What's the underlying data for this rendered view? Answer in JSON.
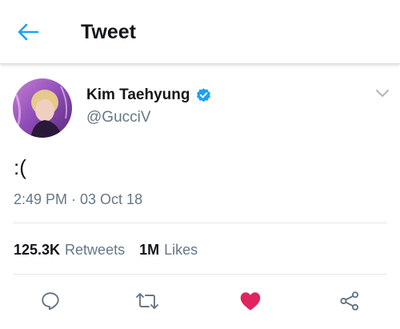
{
  "header": {
    "title": "Tweet",
    "back_icon": "back-arrow-icon",
    "accent_color": "#1da1f2"
  },
  "tweet": {
    "author": {
      "name": "Kim Taehyung",
      "handle": "@GucciV",
      "verified": true,
      "verified_icon": "verified-badge-icon"
    },
    "text": ":(",
    "timestamp": "2:49 PM · 03 Oct 18",
    "menu_icon": "chevron-down-icon"
  },
  "stats": {
    "retweets_count": "125.3K",
    "retweets_label": "Retweets",
    "likes_count": "1M",
    "likes_label": "Likes"
  },
  "actions": [
    {
      "name": "reply",
      "icon": "reply-icon"
    },
    {
      "name": "retweet",
      "icon": "retweet-icon"
    },
    {
      "name": "like",
      "icon": "heart-icon",
      "active": true,
      "color": "#e0245e"
    },
    {
      "name": "share",
      "icon": "share-icon"
    }
  ]
}
